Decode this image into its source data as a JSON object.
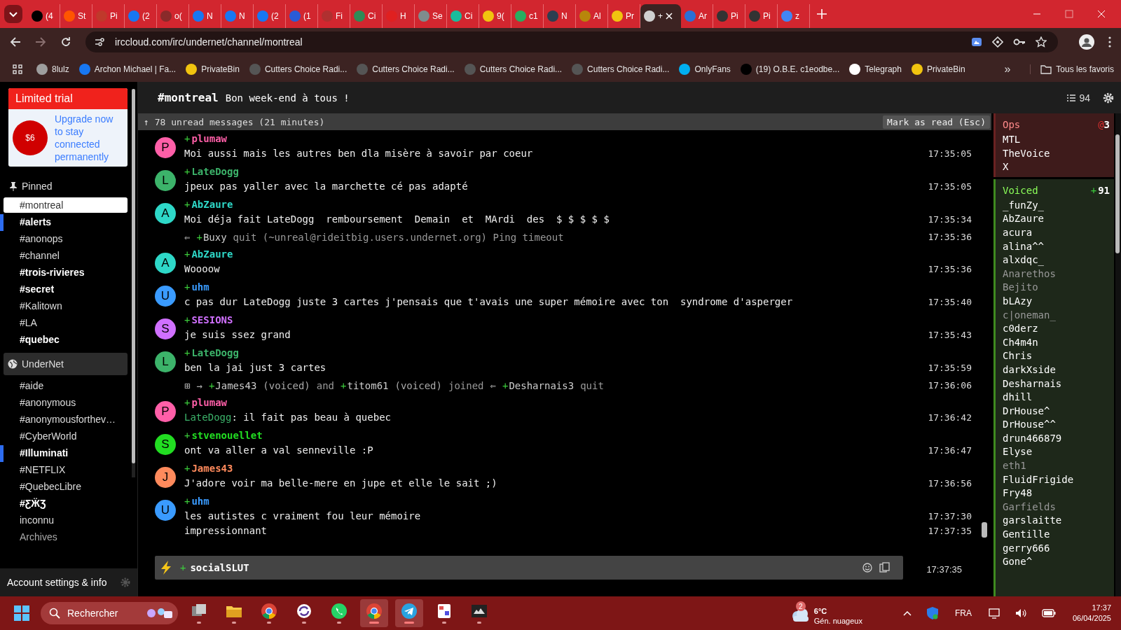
{
  "browser": {
    "tabs": [
      {
        "label": "(4",
        "color": "#000000",
        "selected": false
      },
      {
        "label": "St",
        "color": "#ff5500",
        "selected": false
      },
      {
        "label": "Pi",
        "color": "#c0392b",
        "selected": false
      },
      {
        "label": "(2",
        "color": "#1877f2",
        "selected": false
      },
      {
        "label": "o(",
        "color": "#8a2a2a",
        "selected": false
      },
      {
        "label": "N",
        "color": "#1877f2",
        "selected": false
      },
      {
        "label": "N",
        "color": "#1877f2",
        "selected": false
      },
      {
        "label": "(2",
        "color": "#1877f2",
        "selected": false
      },
      {
        "label": "(1",
        "color": "#2a5bd7",
        "selected": false
      },
      {
        "label": "Fi",
        "color": "#b03030",
        "selected": false
      },
      {
        "label": "Ci",
        "color": "#2e8b57",
        "selected": false
      },
      {
        "label": "H",
        "color": "#e02020",
        "selected": false
      },
      {
        "label": "Se",
        "color": "#7f8c8d",
        "selected": false
      },
      {
        "label": "Ci",
        "color": "#1abc9c",
        "selected": false
      },
      {
        "label": "9(",
        "color": "#f1c40f",
        "selected": false
      },
      {
        "label": "c1",
        "color": "#27ae60",
        "selected": false
      },
      {
        "label": "N",
        "color": "#2c3e50",
        "selected": false
      },
      {
        "label": "Al",
        "color": "#b8860b",
        "selected": false
      },
      {
        "label": "Pr",
        "color": "#f1c40f",
        "selected": false
      },
      {
        "label": "+",
        "color": "#d0d0d0",
        "selected": true
      },
      {
        "label": "Ar",
        "color": "#2a6fd7",
        "selected": false
      },
      {
        "label": "Pi",
        "color": "#333333",
        "selected": false
      },
      {
        "label": "Pi",
        "color": "#333333",
        "selected": false
      },
      {
        "label": "z",
        "color": "#4285f4",
        "selected": false
      }
    ],
    "address": "irccloud.com/irc/undernet/channel/montreal",
    "bookmarks": [
      {
        "label": "8lulz",
        "color": "#9e9e9e"
      },
      {
        "label": "Archon Michael | Fa...",
        "color": "#1877f2"
      },
      {
        "label": "PrivateBin",
        "color": "#f1c40f"
      },
      {
        "label": "Cutters Choice Radi...",
        "color": "#555555"
      },
      {
        "label": "Cutters Choice Radi...",
        "color": "#555555"
      },
      {
        "label": "Cutters Choice Radi...",
        "color": "#555555"
      },
      {
        "label": "Cutters Choice Radi...",
        "color": "#555555"
      },
      {
        "label": "OnlyFans",
        "color": "#00aff0"
      },
      {
        "label": "(19) O.B.E. c1eodbe...",
        "color": "#000000"
      },
      {
        "label": "Telegraph",
        "color": "#ffffff"
      },
      {
        "label": "PrivateBin",
        "color": "#f1c40f"
      }
    ],
    "more": "»",
    "all_bookmarks": "Tous les favoris"
  },
  "sidebar": {
    "trial": {
      "title": "Limited trial",
      "price": "$6",
      "text": "Upgrade now to stay connected permanently"
    },
    "sections": [
      {
        "kind": "pinned",
        "title": "Pinned",
        "channels": [
          {
            "name": "#montreal",
            "selected": true,
            "unread": false,
            "highlight": false
          },
          {
            "name": "#alerts",
            "selected": false,
            "unread": true,
            "highlight": true
          },
          {
            "name": "#anonops",
            "selected": false,
            "unread": false,
            "highlight": false
          },
          {
            "name": "#channel",
            "selected": false,
            "unread": false,
            "highlight": false
          },
          {
            "name": "#trois-rivieres",
            "selected": false,
            "unread": true,
            "highlight": false
          },
          {
            "name": "#secret",
            "selected": false,
            "unread": true,
            "highlight": false
          },
          {
            "name": "#Kalitown",
            "selected": false,
            "unread": false,
            "highlight": false
          },
          {
            "name": "#LA",
            "selected": false,
            "unread": false,
            "highlight": false
          },
          {
            "name": "#quebec",
            "selected": false,
            "unread": true,
            "highlight": false
          }
        ]
      },
      {
        "kind": "network",
        "title": "UnderNet",
        "channels": [
          {
            "name": "#aide",
            "selected": false,
            "unread": false,
            "highlight": false
          },
          {
            "name": "#anonymous",
            "selected": false,
            "unread": false,
            "highlight": false
          },
          {
            "name": "#anonymousforthev…",
            "selected": false,
            "unread": false,
            "highlight": false
          },
          {
            "name": "#CyberWorld",
            "selected": false,
            "unread": false,
            "highlight": false
          },
          {
            "name": "#Illuminati",
            "selected": false,
            "unread": true,
            "highlight": true
          },
          {
            "name": "#NETFLIX",
            "selected": false,
            "unread": false,
            "highlight": false
          },
          {
            "name": "#QuebecLibre",
            "selected": false,
            "unread": false,
            "highlight": false
          },
          {
            "name": "#ƸӜƷ",
            "selected": false,
            "unread": true,
            "highlight": false
          },
          {
            "name": "inconnu",
            "selected": false,
            "unread": false,
            "highlight": false
          }
        ],
        "archives": "Archives"
      }
    ],
    "footer": "Account settings & info"
  },
  "channel": {
    "name": "#montreal",
    "topic": "Bon week-end à tous !",
    "member_count": "94"
  },
  "unread_bar": {
    "text": "↑ 78 unread messages (21 minutes)",
    "button": "Mark as read (Esc)"
  },
  "messages": [
    {
      "kind": "message",
      "nick": "plumaw",
      "initial": "P",
      "color": "#ff5fa8",
      "prefix": "+",
      "lines": [
        {
          "text": "Moi aussi mais les autres ben dla misère à savoir par coeur",
          "time": "17:35:05"
        }
      ]
    },
    {
      "kind": "message",
      "nick": "LateDogg",
      "initial": "L",
      "color": "#3cb36a",
      "prefix": "+",
      "lines": [
        {
          "text": "jpeux pas yaller avec la marchette cé pas adapté",
          "time": "17:35:05"
        }
      ]
    },
    {
      "kind": "message",
      "nick": "AbZaure",
      "initial": "A",
      "color": "#2ed8c8",
      "prefix": "+",
      "lines": [
        {
          "text": "Moi déja fait LateDogg  remboursement  Demain  et  MArdi  des  $ $ $ $ $",
          "time": "17:35:34"
        }
      ]
    },
    {
      "kind": "event",
      "time": "17:35:36",
      "parts": [
        {
          "kind": "symbol",
          "text": "⇐"
        },
        {
          "kind": "nick",
          "prefix": "+",
          "text": "Buxy"
        },
        {
          "kind": "text",
          "text": "quit (~unreal@rideitbig.users.undernet.org) Ping timeout"
        }
      ]
    },
    {
      "kind": "message",
      "nick": "AbZaure",
      "initial": "A",
      "color": "#2ed8c8",
      "prefix": "+",
      "lines": [
        {
          "text": "Woooow",
          "time": "17:35:36"
        }
      ]
    },
    {
      "kind": "message",
      "nick": "uhm",
      "initial": "U",
      "color": "#3a9bff",
      "prefix": "+",
      "lines": [
        {
          "text": "c pas dur LateDogg juste 3 cartes j'pensais que t'avais une super mémoire avec ton  syndrome d'asperger",
          "time": "17:35:40"
        }
      ]
    },
    {
      "kind": "message",
      "nick": "SESIONS",
      "initial": "S",
      "color": "#d070ff",
      "prefix": "+",
      "lines": [
        {
          "text": "je suis ssez grand",
          "time": "17:35:43"
        }
      ]
    },
    {
      "kind": "message",
      "nick": "LateDogg",
      "initial": "L",
      "color": "#3cb36a",
      "prefix": "+",
      "lines": [
        {
          "text": "ben la jai just 3 cartes",
          "time": "17:35:59"
        }
      ]
    },
    {
      "kind": "event",
      "time": "17:36:06",
      "parts": [
        {
          "kind": "symbol",
          "text": "⊞"
        },
        {
          "kind": "symbol",
          "text": "→"
        },
        {
          "kind": "nick",
          "prefix": "+",
          "text": "James43"
        },
        {
          "kind": "note",
          "text": "(voiced)"
        },
        {
          "kind": "text",
          "text": "and"
        },
        {
          "kind": "nick",
          "prefix": "+",
          "text": "titom61"
        },
        {
          "kind": "note",
          "text": "(voiced)"
        },
        {
          "kind": "text",
          "text": "joined"
        },
        {
          "kind": "symbol",
          "text": "⇐"
        },
        {
          "kind": "nick",
          "prefix": "+",
          "text": "Desharnais3"
        },
        {
          "kind": "text",
          "text": "quit"
        }
      ]
    },
    {
      "kind": "message",
      "nick": "plumaw",
      "initial": "P",
      "color": "#ff5fa8",
      "prefix": "+",
      "lines": [
        {
          "mention": "LateDogg",
          "text": ": il fait pas beau à quebec",
          "time": "17:36:42"
        }
      ]
    },
    {
      "kind": "message",
      "nick": "stvenouellet",
      "initial": "S",
      "color": "#22dd22",
      "prefix": "+",
      "lines": [
        {
          "text": "ont va aller a val senneville :P",
          "time": "17:36:47"
        }
      ]
    },
    {
      "kind": "message",
      "nick": "James43",
      "initial": "J",
      "color": "#ff8a5c",
      "prefix": "+",
      "lines": [
        {
          "text": "J'adore voir ma belle-mere en jupe et elle le sait ;)",
          "time": "17:36:56"
        }
      ]
    },
    {
      "kind": "message",
      "nick": "uhm",
      "initial": "U",
      "color": "#3a9bff",
      "prefix": "+",
      "lines": [
        {
          "text": "les autistes c vraiment fou leur mémoire",
          "time": "17:37:30"
        },
        {
          "text": "impressionnant",
          "time": "17:37:35"
        }
      ]
    }
  ],
  "input": {
    "prefix": "+",
    "nick": "socialSLUT",
    "time": "17:37:35"
  },
  "userlist": {
    "groups": [
      {
        "kind": "ops",
        "title": "Ops",
        "count_prefix": "@",
        "count": "3",
        "members": [
          {
            "name": "MTL",
            "away": false
          },
          {
            "name": "TheVoice",
            "away": false
          },
          {
            "name": "X",
            "away": false
          }
        ]
      },
      {
        "kind": "voiced",
        "title": "Voiced",
        "count_prefix": "+",
        "count": "91",
        "members": [
          {
            "name": "_funZy_",
            "away": false
          },
          {
            "name": "AbZaure",
            "away": false
          },
          {
            "name": "acura",
            "away": false
          },
          {
            "name": "alina^^",
            "away": false
          },
          {
            "name": "alxdqc_",
            "away": false
          },
          {
            "name": "Anarethos",
            "away": true
          },
          {
            "name": "Bejito",
            "away": true
          },
          {
            "name": "bLAzy",
            "away": false
          },
          {
            "name": "c|oneman_",
            "away": true
          },
          {
            "name": "c0derz",
            "away": false
          },
          {
            "name": "Ch4m4n",
            "away": false
          },
          {
            "name": "Chris",
            "away": false
          },
          {
            "name": "darkXside",
            "away": false
          },
          {
            "name": "Desharnais",
            "away": false
          },
          {
            "name": "dhill",
            "away": false
          },
          {
            "name": "DrHouse^",
            "away": false
          },
          {
            "name": "DrHouse^^",
            "away": false
          },
          {
            "name": "drun466879",
            "away": false
          },
          {
            "name": "Elyse",
            "away": false
          },
          {
            "name": "eth1",
            "away": true
          },
          {
            "name": "FluidFrigide",
            "away": false
          },
          {
            "name": "Fry48",
            "away": false
          },
          {
            "name": "Garfields",
            "away": true
          },
          {
            "name": "garslaitte",
            "away": false
          },
          {
            "name": "Gentille",
            "away": false
          },
          {
            "name": "gerry666",
            "away": false
          },
          {
            "name": "Gone^",
            "away": false
          }
        ]
      }
    ]
  },
  "taskbar": {
    "search": "Rechercher",
    "apps": [
      {
        "kind": "taskview",
        "active": false
      },
      {
        "kind": "folder",
        "active": false
      },
      {
        "kind": "chrome",
        "active": false
      },
      {
        "kind": "sync",
        "active": false
      },
      {
        "kind": "whatsapp",
        "active": false
      },
      {
        "kind": "chrome",
        "active": true
      },
      {
        "kind": "telegram",
        "active": true
      },
      {
        "kind": "snip",
        "active": false
      },
      {
        "kind": "game",
        "active": false
      }
    ],
    "weather": {
      "badge": "2",
      "temp": "6°C",
      "text": "Gén. nuageux"
    },
    "language": "FRA",
    "time": "17:37",
    "date": "06/04/2025"
  }
}
